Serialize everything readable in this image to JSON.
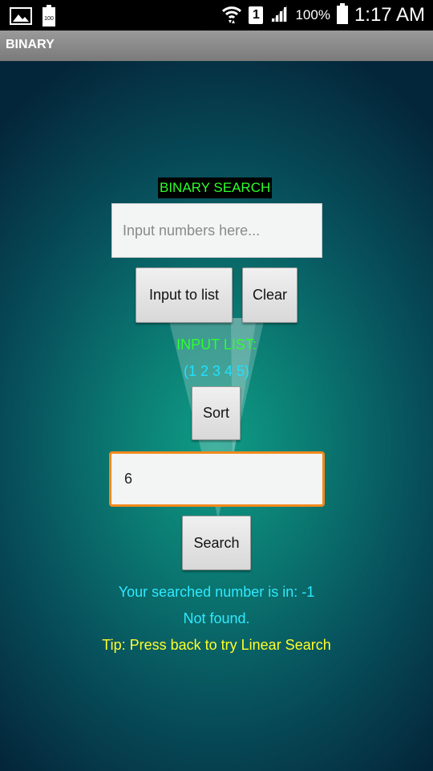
{
  "status_bar": {
    "battery_icon_label": "100",
    "sim_label": "1",
    "battery_percent": "100%",
    "time": "1:17 AM",
    "icons": [
      "gallery-icon",
      "battery-icon",
      "wifi-icon",
      "sim-icon",
      "signal-icon"
    ]
  },
  "action_bar": {
    "title": "BINARY"
  },
  "main": {
    "heading": "BINARY SEARCH",
    "numbers_input": {
      "value": "",
      "placeholder": "Input numbers here..."
    },
    "input_to_list_button": "Input to list",
    "clear_button": "Clear",
    "input_list_label": "INPUT LIST:",
    "input_list_items": "(1 2 3 4 5)",
    "sort_button": "Sort",
    "search_input": {
      "value": "6",
      "placeholder": ""
    },
    "search_button": "Search",
    "result_text": "Your searched number is in: -1",
    "not_found_text": "Not found.",
    "tip_text": "Tip: Press back to try Linear Search"
  },
  "colors": {
    "heading_text": "#2bff2b",
    "result_text": "#2fe9ff",
    "tip_text": "#ffff2a",
    "focus_border": "#f18a1c"
  }
}
